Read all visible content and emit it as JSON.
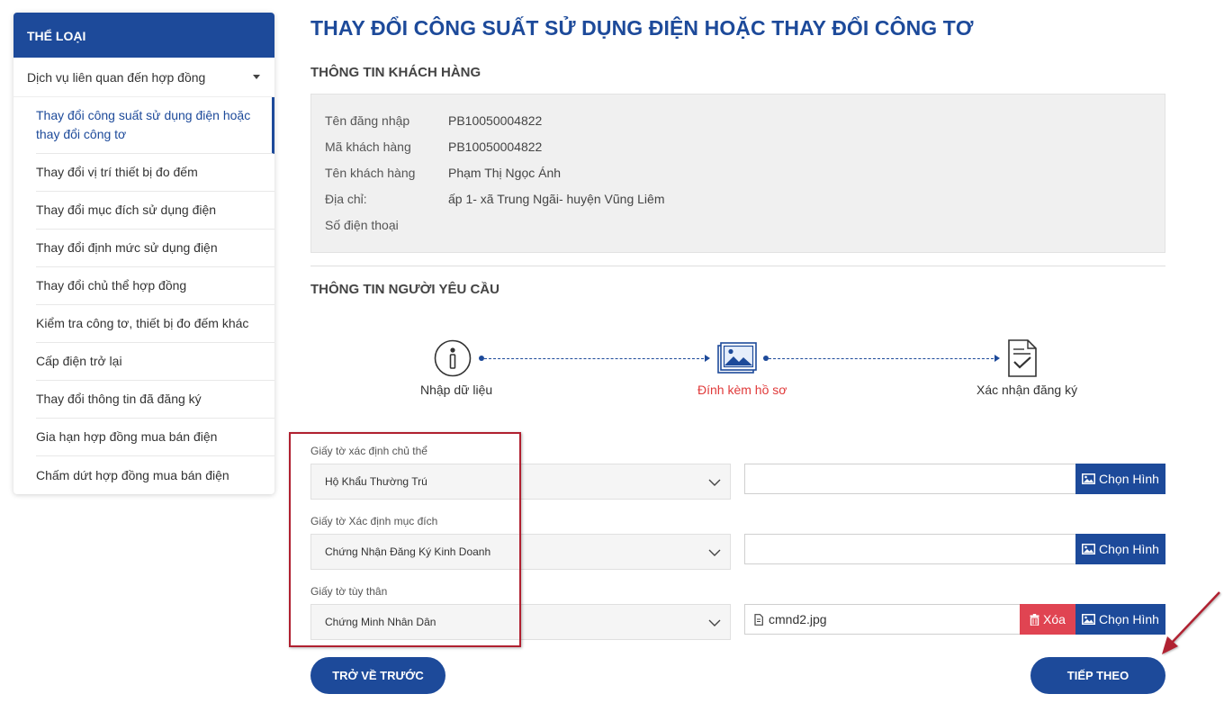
{
  "sidebar": {
    "header": "THỂ LOẠI",
    "group_label": "Dịch vụ liên quan đến hợp đồng",
    "items": [
      {
        "label": "Thay đổi công suất sử dụng điện hoặc thay đổi công tơ"
      },
      {
        "label": "Thay đổi vị trí thiết bị đo đếm"
      },
      {
        "label": "Thay đổi mục đích sử dụng điện"
      },
      {
        "label": "Thay đổi định mức sử dụng điện"
      },
      {
        "label": "Thay đổi chủ thể hợp đồng"
      },
      {
        "label": "Kiểm tra công tơ, thiết bị đo đếm khác"
      },
      {
        "label": "Cấp điện trở lại"
      },
      {
        "label": "Thay đổi thông tin đã đăng ký"
      },
      {
        "label": "Gia hạn hợp đồng mua bán điện"
      },
      {
        "label": "Chấm dứt hợp đồng mua bán điện"
      }
    ]
  },
  "page": {
    "title": "THAY ĐỔI CÔNG SUẤT SỬ DỤNG ĐIỆN HOẶC THAY ĐỔI CÔNG TƠ",
    "customer_section": "THÔNG TIN KHÁCH HÀNG",
    "requester_section": "THÔNG TIN NGƯỜI YÊU CẦU"
  },
  "customer": [
    {
      "label": "Tên đăng nhập",
      "value": "PB10050004822"
    },
    {
      "label": "Mã khách hàng",
      "value": "PB10050004822"
    },
    {
      "label": "Tên khách hàng",
      "value": "Phạm Thị Ngọc Ánh"
    },
    {
      "label": "Địa chỉ:",
      "value": "ấp 1- xã Trung Ngãi- huyện Vũng Liêm"
    },
    {
      "label": "Số điện thoại",
      "value": ""
    }
  ],
  "steps": [
    {
      "label": "Nhập dữ liệu",
      "icon": "info-icon"
    },
    {
      "label": "Đính kèm hồ sơ",
      "icon": "image-icon",
      "active": true
    },
    {
      "label": "Xác nhận đăng ký",
      "icon": "document-check-icon"
    }
  ],
  "form": {
    "fields": [
      {
        "label": "Giấy tờ xác định chủ thể",
        "selected": "Hộ Khẩu Thường Trú",
        "file": ""
      },
      {
        "label": "Giấy tờ Xác định mục đích",
        "selected": "Chứng Nhận Đăng Ký Kinh Doanh",
        "file": ""
      },
      {
        "label": "Giấy tờ tùy thân",
        "selected": "Chứng Minh Nhân Dân",
        "file": "cmnd2.jpg"
      }
    ],
    "choose_label": "Chọn Hình",
    "delete_label": "Xóa"
  },
  "buttons": {
    "back": "TRỞ VỀ TRƯỚC",
    "next": "TIẾP THEO"
  },
  "colors": {
    "primary": "#1d4a9a",
    "danger": "#e04452",
    "active_step": "#e03a3a",
    "annotation": "#b02030"
  }
}
